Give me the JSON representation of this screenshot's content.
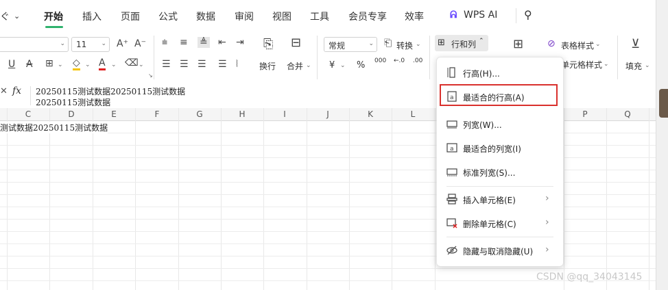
{
  "menubar": {
    "partial_left": "ぐ",
    "tabs": [
      "开始",
      "插入",
      "页面",
      "公式",
      "数据",
      "审阅",
      "视图",
      "工具",
      "会员专享",
      "效率"
    ],
    "wps_ai": "WPS AI"
  },
  "ribbon": {
    "font_size": "11",
    "grow_font": "A⁺",
    "shrink_font": "A⁻",
    "wrap_label": "换行",
    "merge_label": "合并",
    "number_format": "常规",
    "convert_label": "转换",
    "rows_cols_label": "行和列",
    "table_style_label": "表格样式",
    "cell_style_label": "单元格样式",
    "fill_label": "填充",
    "currency": "¥",
    "percent": "%",
    "thousands": "000"
  },
  "formulabar": {
    "fx": "fx",
    "line1": "20250115测试数据20250115测试数据",
    "line2": "20250115测试数据"
  },
  "grid": {
    "columns": [
      "C",
      "D",
      "E",
      "F",
      "G",
      "H",
      "I",
      "J",
      "K",
      "L",
      "P",
      "Q"
    ],
    "cell_text": "测试数据20250115测试数据"
  },
  "dropdown": {
    "items": [
      {
        "label": "行高(H)...",
        "icon": "row-height-icon"
      },
      {
        "label": "最适合的行高(A)",
        "icon": "autofit-row-icon"
      },
      {
        "label": "列宽(W)...",
        "icon": "column-width-icon"
      },
      {
        "label": "最适合的列宽(I)",
        "icon": "autofit-column-icon"
      },
      {
        "label": "标准列宽(S)...",
        "icon": "standard-width-icon"
      },
      {
        "label": "插入单元格(E)",
        "icon": "insert-cell-icon"
      },
      {
        "label": "删除单元格(C)",
        "icon": "delete-cell-icon"
      },
      {
        "label": "隐藏与取消隐藏(U)",
        "icon": "hide-icon"
      }
    ],
    "highlight_color": "#d9302c"
  },
  "watermark": "CSDN @qq_34043145",
  "colors": {
    "accent": "#2fb26d",
    "ai_purple": "#6b4cff"
  }
}
